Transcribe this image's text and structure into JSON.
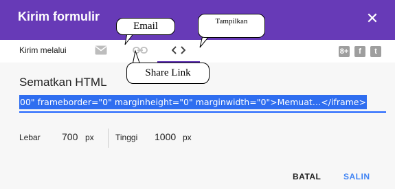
{
  "dialog": {
    "title": "Kirim formulir",
    "close_icon": "close-icon"
  },
  "send_via": {
    "label": "Kirim melalui",
    "icons": [
      "email-icon",
      "link-icon",
      "embed-icon"
    ],
    "active": "embed",
    "social": [
      {
        "name": "google-plus-icon",
        "glyph": "8+"
      },
      {
        "name": "facebook-icon",
        "glyph": "f"
      },
      {
        "name": "twitter-icon",
        "glyph": "t"
      }
    ]
  },
  "embed": {
    "title": "Sematkan HTML",
    "code": "00\" frameborder=\"0\" marginheight=\"0\" marginwidth=\"0\">Memuat…</iframe>",
    "width_label": "Lebar",
    "width_value": "700",
    "width_unit": "px",
    "height_label": "Tinggi",
    "height_value": "1000",
    "height_unit": "px"
  },
  "buttons": {
    "cancel": "BATAL",
    "copy": "SALIN"
  },
  "annotations": {
    "email": "Email",
    "show": "Tampilkan",
    "share_link": "Share Link"
  },
  "colors": {
    "header": "#673ab7",
    "accent_blue": "#4285f4",
    "selection": "#2f6ef0"
  }
}
